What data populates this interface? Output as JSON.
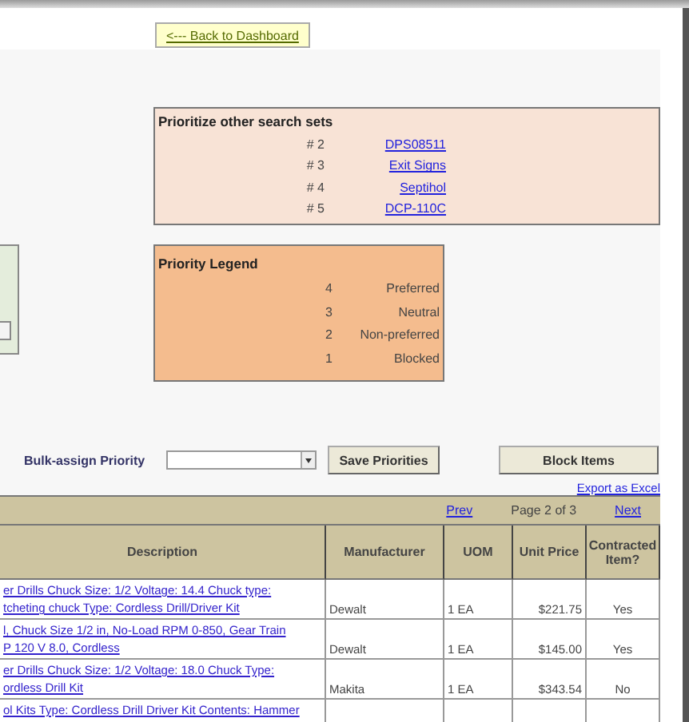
{
  "back_button": "<--- Back to Dashboard",
  "other_searches": {
    "title": "Prioritize other search sets",
    "items": [
      {
        "rank": "# 2",
        "link": "DPS08511"
      },
      {
        "rank": "# 3",
        "link": "Exit Signs"
      },
      {
        "rank": "# 4",
        "link": "Septihol"
      },
      {
        "rank": "# 5",
        "link": "DCP-110C"
      }
    ]
  },
  "legend": {
    "title": "Priority Legend",
    "items": [
      {
        "value": "4",
        "label": "Preferred"
      },
      {
        "value": "3",
        "label": "Neutral"
      },
      {
        "value": "2",
        "label": "Non-preferred"
      },
      {
        "value": "1",
        "label": "Blocked"
      }
    ]
  },
  "bulk": {
    "label": "Bulk-assign Priority",
    "save_button": "Save Priorities",
    "block_button": "Block Items"
  },
  "export_link": "Export as Excel",
  "pager": {
    "prev": "Prev",
    "page": "Page 2 of 3",
    "next": "Next"
  },
  "table": {
    "columns": [
      "Description",
      "Manufacturer",
      "UOM",
      "Unit Price",
      "Contracted Item?"
    ],
    "rows": [
      {
        "description": [
          "er Drills Chuck Size: 1/2 Voltage: 14.4 Chuck type:",
          "tcheting chuck Type: Cordless Drill/Driver Kit"
        ],
        "manufacturer": "Dewalt",
        "uom": "1 EA",
        "price": "$221.75",
        "contracted": "Yes"
      },
      {
        "description": [
          "l, Chuck Size 1/2 in, No-Load RPM 0-850, Gear Train",
          "P 120 V 8.0, Cordless"
        ],
        "manufacturer": "Dewalt",
        "uom": "1 EA",
        "price": "$145.00",
        "contracted": "Yes"
      },
      {
        "description": [
          "er Drills Chuck Size: 1/2 Voltage: 18.0 Chuck Type:",
          "ordless Drill Kit"
        ],
        "manufacturer": "Makita",
        "uom": "1 EA",
        "price": "$343.54",
        "contracted": "No"
      },
      {
        "description": [
          "ol Kits Type: Cordless Drill Driver Kit Contents: Hammer"
        ]
      }
    ]
  }
}
